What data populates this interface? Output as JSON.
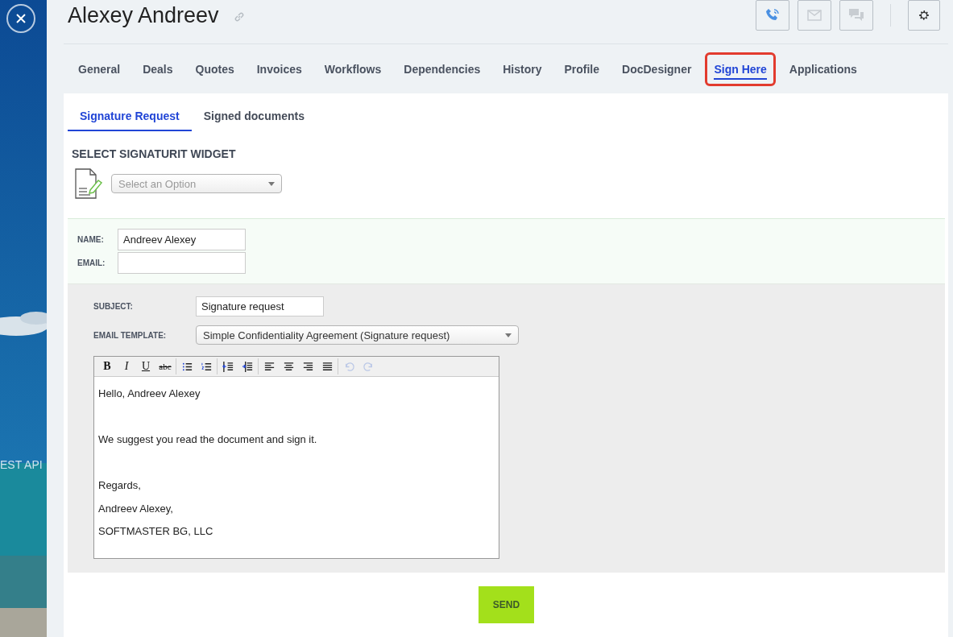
{
  "side_panel": {
    "background_text": "EST API"
  },
  "header": {
    "title": "Alexey Andreev",
    "actions": [
      {
        "kind": "phone",
        "active": true
      },
      {
        "kind": "mail",
        "active": false
      },
      {
        "kind": "chat",
        "active": false
      }
    ]
  },
  "tabs": [
    {
      "label": "General",
      "selected": false
    },
    {
      "label": "Deals",
      "selected": false
    },
    {
      "label": "Quotes",
      "selected": false
    },
    {
      "label": "Invoices",
      "selected": false
    },
    {
      "label": "Workflows",
      "selected": false
    },
    {
      "label": "Dependencies",
      "selected": false
    },
    {
      "label": "History",
      "selected": false
    },
    {
      "label": "Profile",
      "selected": false
    },
    {
      "label": "DocDesigner",
      "selected": false
    },
    {
      "label": "Sign Here",
      "selected": true
    },
    {
      "label": "Applications",
      "selected": false
    }
  ],
  "subtabs": [
    {
      "label": "Signature Request",
      "selected": true
    },
    {
      "label": "Signed documents",
      "selected": false
    }
  ],
  "widget": {
    "heading": "SELECT SIGNATURIT WIDGET",
    "select_placeholder": "Select an Option"
  },
  "recipient": {
    "name_label": "NAME:",
    "name_value": "Andreev Alexey",
    "email_label": "EMAIL:"
  },
  "email": {
    "subject_label": "SUBJECT:",
    "subject_value": "Signature request",
    "template_label": "EMAIL TEMPLATE:",
    "template_value": "Simple Confidentiality Agreement (Signature request)"
  },
  "toolbar": [
    {
      "kind": "bold",
      "label": "B",
      "disabled": false
    },
    {
      "kind": "italic",
      "label": "I",
      "disabled": false
    },
    {
      "kind": "underline",
      "label": "U",
      "disabled": false
    },
    {
      "kind": "strike",
      "label": "abc",
      "disabled": false
    },
    {
      "kind": "bullets",
      "disabled": false
    },
    {
      "kind": "numbers",
      "disabled": false
    },
    {
      "kind": "outdent",
      "disabled": false
    },
    {
      "kind": "indent",
      "disabled": false
    },
    {
      "kind": "align-left",
      "disabled": false
    },
    {
      "kind": "align-center",
      "disabled": false
    },
    {
      "kind": "align-right",
      "disabled": false
    },
    {
      "kind": "justify",
      "disabled": false
    },
    {
      "kind": "undo",
      "disabled": true
    },
    {
      "kind": "redo",
      "disabled": true
    }
  ],
  "body_lines": [
    {
      "text": "Hello, Andreev Alexey",
      "blank_before": false
    },
    {
      "text": "We suggest you read the document and sign it.",
      "blank_before": true
    },
    {
      "text": "Regards,",
      "blank_before": true
    },
    {
      "text": "Andreev Alexey,",
      "blank_before": false
    },
    {
      "text": "SOFTMASTER BG, LLC",
      "blank_before": false
    }
  ],
  "send_button": "SEND"
}
